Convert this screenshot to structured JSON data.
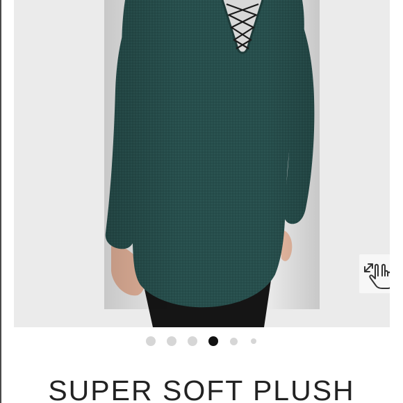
{
  "product": {
    "image_alt": "Back view of dark green lace-up back tunic sweater",
    "title": "SUPER SOFT PLUSH",
    "colors": {
      "garment": "#274e4c",
      "background": "#ebebeb",
      "active_dot": "#111111",
      "inactive_dot": "#d6d6d6"
    }
  },
  "gallery": {
    "slide_count": 6,
    "active_index": 3,
    "zoom_icon": "expand-hand-icon"
  }
}
